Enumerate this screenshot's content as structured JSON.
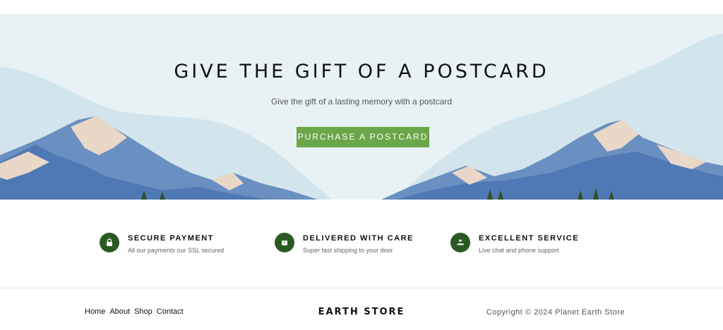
{
  "hero": {
    "title": "GIVE THE GIFT OF A POSTCARD",
    "subtitle": "Give the gift of a lasting memory with a postcard",
    "cta_label": "PURCHASE A POSTCARD",
    "cta_color": "#6aa74a",
    "background_color": "#e8f2f5"
  },
  "features": [
    {
      "icon": "lock-icon",
      "title": "SECURE PAYMENT",
      "description": "All our payments our SSL secured"
    },
    {
      "icon": "box-icon",
      "title": "DELIVERED WITH CARE",
      "description": "Super fast shipping to your door"
    },
    {
      "icon": "hand-heart-icon",
      "title": "EXCELLENT SERVICE",
      "description": "Live chat and phone support"
    }
  ],
  "feature_icon_color": "#2a5a22",
  "footer": {
    "nav": [
      "Home",
      "About",
      "Shop",
      "Contact"
    ],
    "brand": "EARTH STORE",
    "copyright": "Copyright © 2024 Planet Earth Store"
  }
}
